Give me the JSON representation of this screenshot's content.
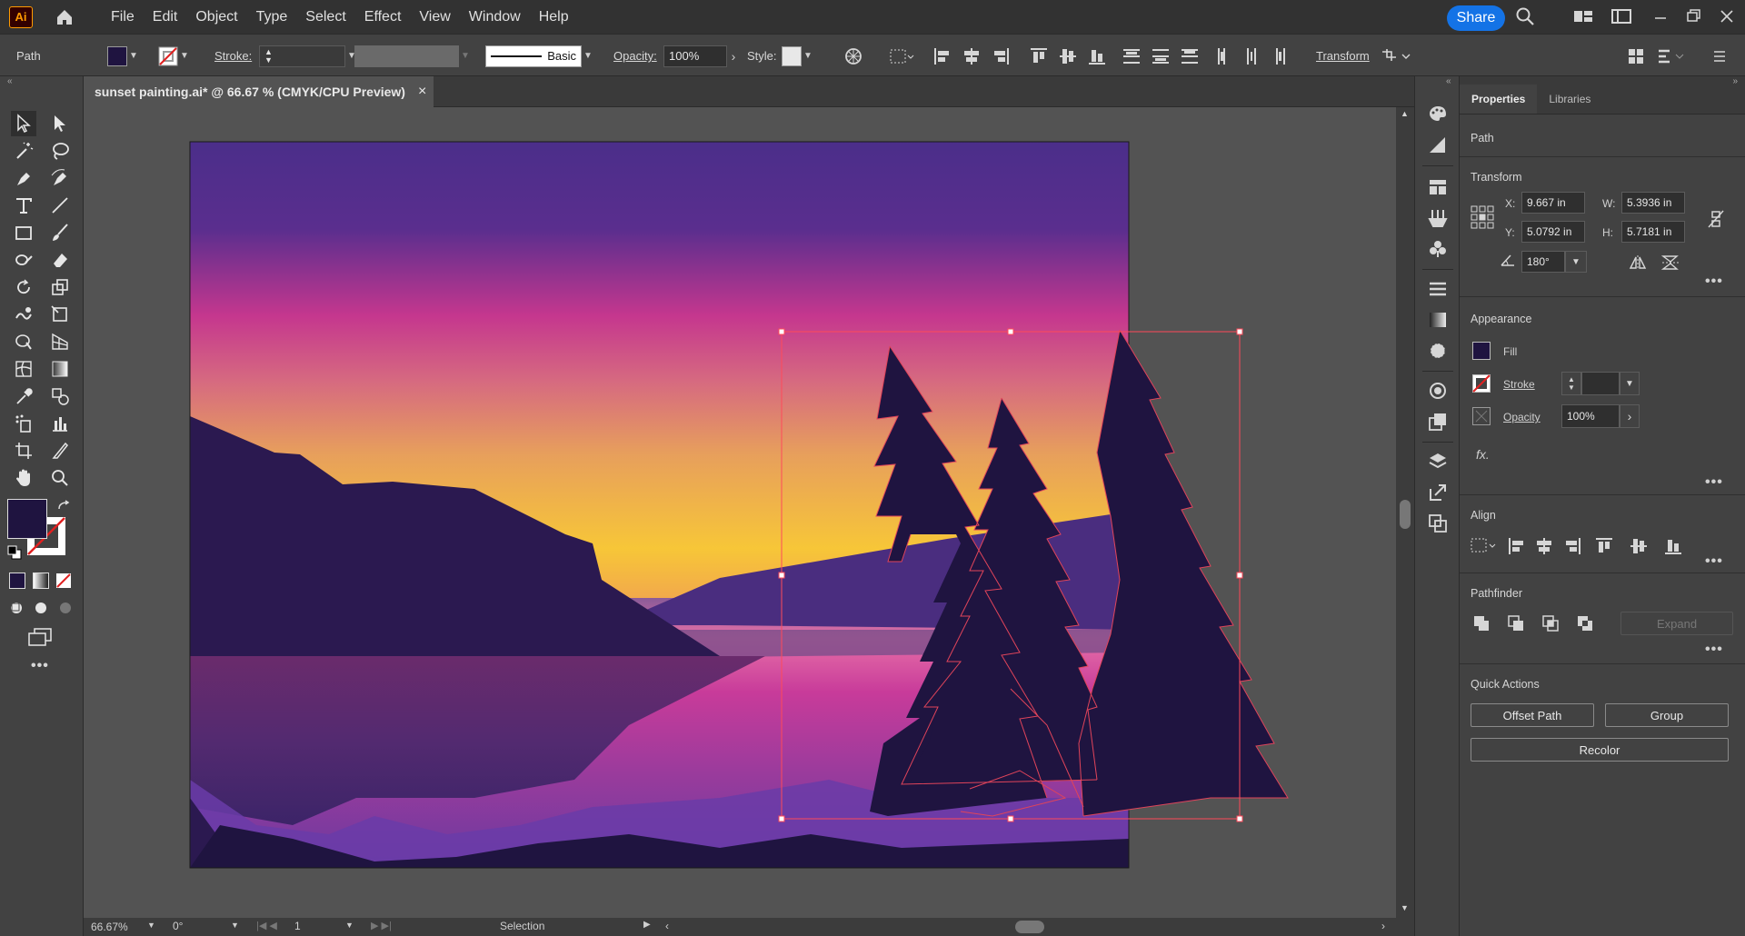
{
  "app": {
    "logo": "Ai",
    "share_label": "Share"
  },
  "menu": [
    "File",
    "Edit",
    "Object",
    "Type",
    "Select",
    "Effect",
    "View",
    "Window",
    "Help"
  ],
  "control": {
    "selection_type": "Path",
    "stroke_label": "Stroke:",
    "brush_label": "Basic",
    "opacity_label": "Opacity:",
    "opacity_value": "100%",
    "style_label": "Style:",
    "transform_label": "Transform"
  },
  "document": {
    "tab_title": "sunset painting.ai* @ 66.67 % (CMYK/CPU Preview)",
    "close": "×"
  },
  "status": {
    "zoom": "66.67%",
    "rotation": "0°",
    "artboard": "1",
    "tool": "Selection"
  },
  "panel": {
    "tabs": [
      "Properties",
      "Libraries"
    ],
    "selection": "Path",
    "transform": {
      "title": "Transform",
      "x_label": "X:",
      "x": "9.667 in",
      "y_label": "Y:",
      "y": "5.0792 in",
      "w_label": "W:",
      "w": "5.3936 in",
      "h_label": "H:",
      "h": "5.7181 in",
      "angle": "180°"
    },
    "appearance": {
      "title": "Appearance",
      "fill_label": "Fill",
      "stroke_label": "Stroke",
      "opacity_label": "Opacity",
      "opacity_value": "100%",
      "fx_label": "fx."
    },
    "align": {
      "title": "Align"
    },
    "pathfinder": {
      "title": "Pathfinder",
      "expand_label": "Expand"
    },
    "quick_actions": {
      "title": "Quick Actions",
      "offset_path": "Offset Path",
      "group": "Group",
      "recolor": "Recolor"
    }
  },
  "colors": {
    "fill": "#1f1440",
    "accent": "#1473e6",
    "selection": "#ff4a5a"
  }
}
